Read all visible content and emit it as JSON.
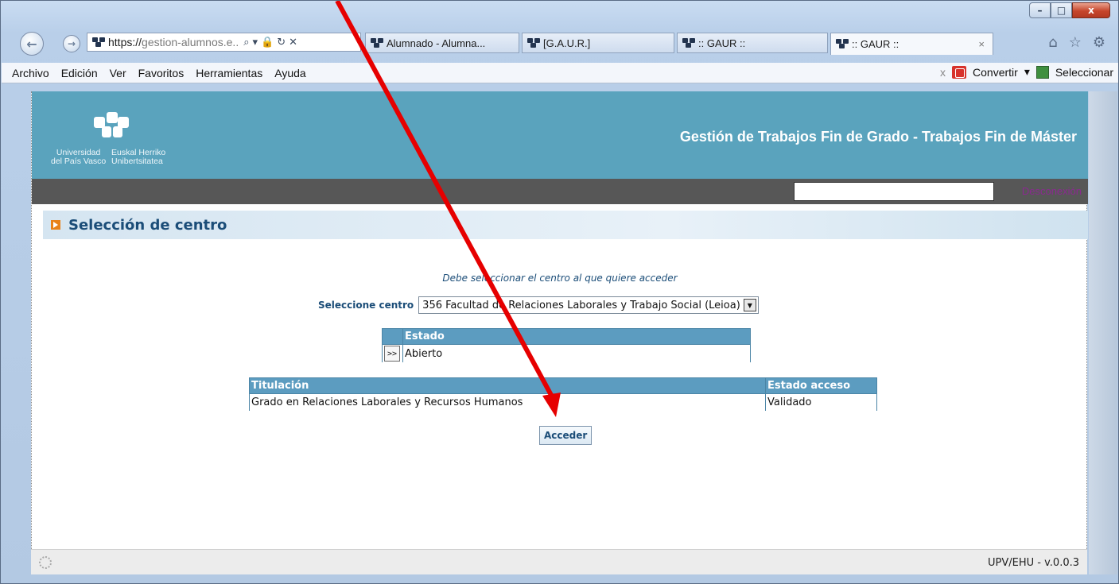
{
  "window": {
    "controls": [
      "–",
      "□",
      "x"
    ]
  },
  "browser": {
    "address_prefix": "https://",
    "address_host": "gestion-alumnos.e..",
    "tabs": [
      {
        "title": "Alumnado - Alumna..."
      },
      {
        "title": "[G.A.U.R.]"
      },
      {
        "title": ":: GAUR ::"
      },
      {
        "title": ":: GAUR ::",
        "active": true
      }
    ],
    "tab_close": "×"
  },
  "menu": {
    "items": [
      "Archivo",
      "Edición",
      "Ver",
      "Favoritos",
      "Herramientas",
      "Ayuda"
    ],
    "convert_label": "Convertir",
    "select_label": "Seleccionar",
    "close_x": "x"
  },
  "header": {
    "uni_es": "Universidad\ndel País Vasco",
    "uni_eu": "Euskal Herriko\nUnibertsitatea",
    "title": "Gestión de Trabajos Fin de Grado - Trabajos Fin de Máster",
    "logout": "Desconexión"
  },
  "section": {
    "title": "Selección de centro"
  },
  "form": {
    "note": "Debe seleccionar el centro al que quiere acceder",
    "select_label": "Seleccione centro",
    "select_value": "356 Facultad de Relaciones Laborales y Trabajo Social (Leioa)",
    "state_header": "Estado",
    "state_row": {
      "button": ">>",
      "value": "Abierto"
    },
    "titulacion_header": "Titulación",
    "estado_acceso_header": "Estado acceso",
    "titulacion_row": {
      "titulacion": "Grado en Relaciones Laborales y Recursos Humanos",
      "estado": "Validado"
    },
    "submit": "Acceder"
  },
  "footer": {
    "version": "UPV/EHU - v.0.0.3"
  },
  "colors": {
    "banner": "#5aa3bd",
    "darkbar": "#575757",
    "heading_text": "#1b4d78",
    "arrow": "#e60000"
  }
}
